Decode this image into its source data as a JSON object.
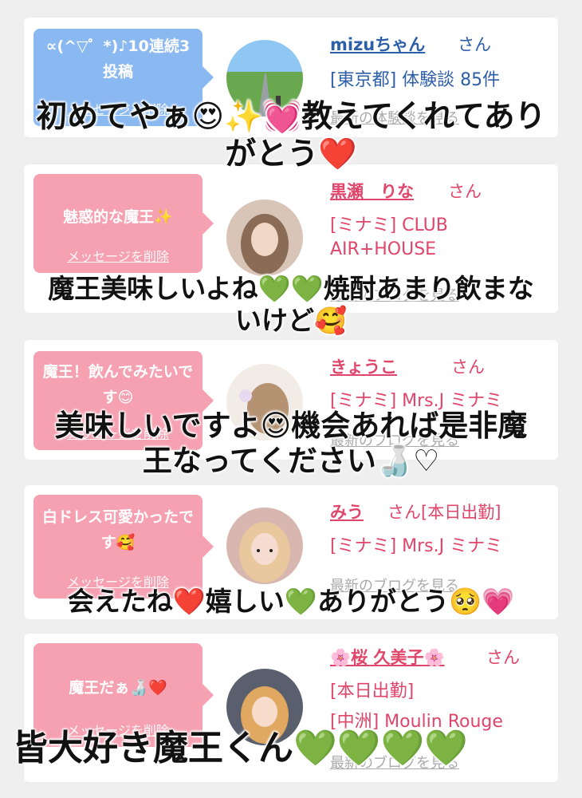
{
  "delete_label": "メッセージを削除",
  "blog_link": "最新のブログを見る",
  "blog_link_taiken": "最新の体験談を見る",
  "san": "さん",
  "cards": [
    {
      "message": "∝(^▽゜*)♪10連続3投稿",
      "bubble_color": "#8ab8f0",
      "name": "mizuちゃん",
      "name_color": "#2d5fa8",
      "info": [
        "[東京都] 体験談 85件"
      ],
      "info_color": "#2d5fa8"
    },
    {
      "message": "魅惑的な魔王✨",
      "bubble_color": "#f6a1b2",
      "name": "黒瀬　りな",
      "name_color": "#e0456a",
      "info": [
        "[ミナミ] CLUB",
        "AIR+HOUSE"
      ],
      "info_color": "#e0456a"
    },
    {
      "message": "魔王！飲んでみたいです😊",
      "bubble_color": "#f6a1b2",
      "name": "きょうこ",
      "name_color": "#e0456a",
      "info": [
        "[ミナミ] Mrs.J ミナミ"
      ],
      "info_color": "#e0456a"
    },
    {
      "message": "白ドレス可愛かったです🥰",
      "bubble_color": "#f6a1b2",
      "name": "みう",
      "name_color": "#e0456a",
      "san_suffix": "[本日出勤]",
      "info": [
        "[ミナミ] Mrs.J ミナミ"
      ],
      "info_color": "#e0456a"
    },
    {
      "message": "魔王だぁ🍶❤️",
      "bubble_color": "#f6a1b2",
      "name": "🌸桜 久美子🌸",
      "name_color": "#e0456a",
      "info": [
        "[本日出勤]",
        "[中洲] Moulin Rouge"
      ],
      "info_color": "#e0456a"
    }
  ],
  "overlays": [
    {
      "line1": "初めてやぁ😍✨💓教えてくれてあり",
      "line2": "がとう❤️"
    },
    {
      "line1": "魔王美味しいよね💚💚焼酎あまり飲まな",
      "line2": "いけど🥰"
    },
    {
      "line1": "美味しいですよ😍機会あれば是非魔",
      "line2": "王なってください🍶♡"
    },
    {
      "line1": "会えたね❤️嬉しい💚ありがとう🥺💗"
    },
    {
      "line1": "皆大好き魔王くん💚💚💚💚"
    }
  ]
}
